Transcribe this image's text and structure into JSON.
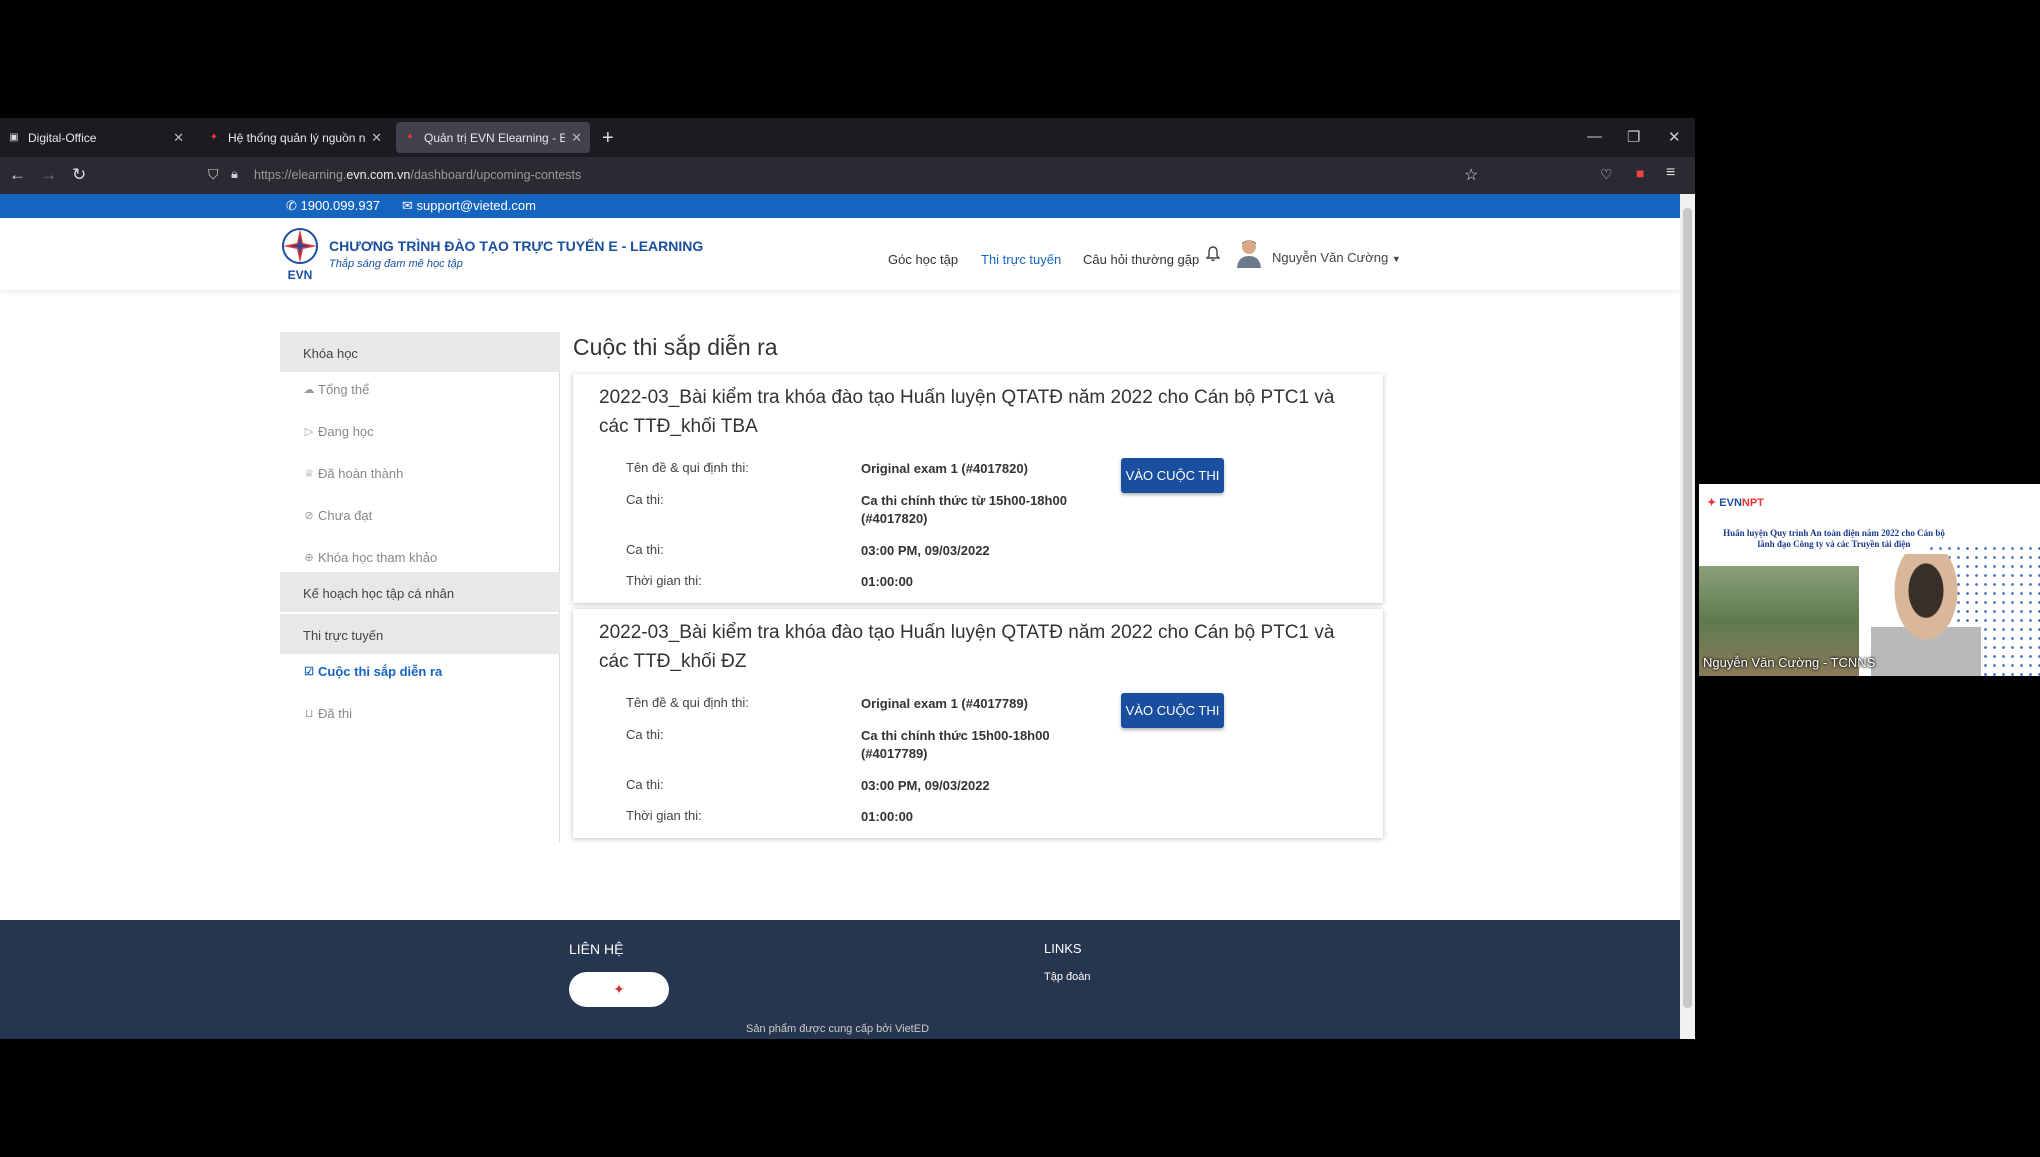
{
  "browser": {
    "tabs": [
      {
        "label": "Digital-Office",
        "active": false
      },
      {
        "label": "Hệ thống quản lý nguồn nhân lực",
        "active": false
      },
      {
        "label": "Quản trị EVN Elearning - EVN Elearning",
        "active": true
      }
    ],
    "url_prefix": "https://elearning.",
    "url_domain": "evn.com.vn",
    "url_path": "/dashboard/upcoming-contests"
  },
  "topstrip": {
    "phone": "1900.099.937",
    "email": "support@vieted.com"
  },
  "header": {
    "logo_text": "EVN",
    "title": "CHƯƠNG TRÌNH ĐÀO TẠO TRỰC TUYẾN E - LEARNING",
    "slogan": "Thắp sáng đam mê học tập",
    "menu": [
      "Góc học tập",
      "Thi trực tuyến",
      "Câu hỏi thường gặp"
    ],
    "user_name": "Nguyễn Văn Cường"
  },
  "sidebar": {
    "section_courses": "Khóa học",
    "course_items": [
      "Tổng thể",
      "Đang học",
      "Đã hoàn thành",
      "Chưa đạt",
      "Khóa học tham khảo"
    ],
    "section_plan": "Kế hoạch học tập cá nhân",
    "section_exams": "Thi trực tuyến",
    "exam_items": [
      "Cuộc thi sắp diễn ra",
      "Đã thi"
    ]
  },
  "main": {
    "title": "Cuộc thi sắp diễn ra",
    "labels": {
      "exam": "Tên đề & qui định thi:",
      "session": "Ca thi:",
      "duration": "Thời gian thi:"
    },
    "enter_label": "VÀO CUỘC THI",
    "contests": [
      {
        "title": "2022-03_Bài kiểm tra khóa đào tạo Huấn luyện QTATĐ năm 2022 cho Cán bộ PTC1 và các TTĐ_khối TBA",
        "exam": "Original exam 1 (#4017820)",
        "session_name": "Ca thi chính thức từ 15h00-18h00 (#4017820)",
        "session_time": "03:00 PM, 09/03/2022",
        "duration": "01:00:00"
      },
      {
        "title": "2022-03_Bài kiểm tra khóa đào tạo Huấn luyện QTATĐ năm 2022 cho Cán bộ PTC1 và các TTĐ_khối ĐZ",
        "exam": "Original exam 1 (#4017789)",
        "session_name": "Ca thi chính thức 15h00-18h00 (#4017789)",
        "session_time": "03:00 PM, 09/03/2022",
        "duration": "01:00:00"
      }
    ]
  },
  "footer": {
    "contact": "LIÊN HỆ",
    "links": "LINKS",
    "link_1": "Tập đoàn",
    "credit": "Sản phẩm được cung cấp bởi VietED"
  },
  "video": {
    "brand_prefix": "EVN",
    "brand_suffix": "NPT",
    "slide_title": "Huấn luyện Quy trình An toàn điện năm 2022 cho Cán bộ lãnh đạo Công ty và các Truyền tải điện",
    "caption": "Nguyễn Văn Cường - TCNNS"
  }
}
